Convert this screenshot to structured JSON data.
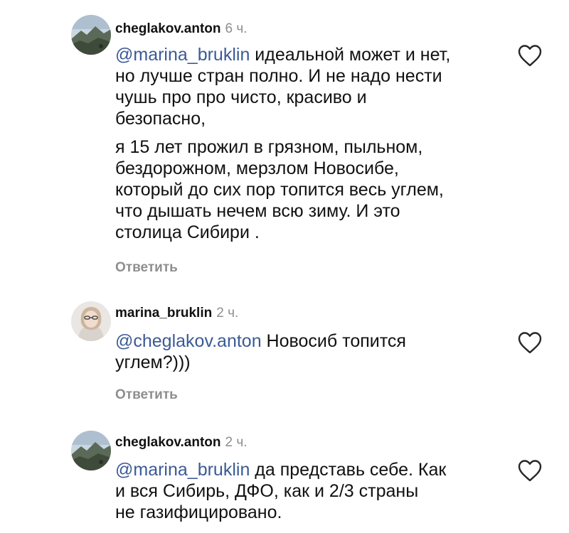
{
  "comments": [
    {
      "username": "cheglakov.anton",
      "time": "6 ч.",
      "mention": "@marina_bruklin",
      "text_first": " идеальной может и нет,",
      "lines_first": [
        "но лучше стран полно. И не надо нести",
        "чушь про про чисто, красиво и",
        "безопасно,"
      ],
      "paragraph_two": [
        "я 15 лет прожил в грязном, пыльном,",
        "бездорожном, мерзлом Новосибе,",
        "который до сих пор топится весь углем,",
        "что дышать нечем всю зиму. И это",
        "столица Сибири ."
      ],
      "reply_label": "Ответить",
      "avatar_icon": "mountain-landscape-avatar",
      "like_icon": "heart-outline-icon"
    },
    {
      "username": "marina_bruklin",
      "time": "2 ч.",
      "mention": "@cheglakov.anton",
      "text_first": " Новосиб топится",
      "lines_first": [
        "углем?)))"
      ],
      "reply_label": "Ответить",
      "avatar_icon": "woman-portrait-avatar",
      "like_icon": "heart-outline-icon"
    },
    {
      "username": "cheglakov.anton",
      "time": "2 ч.",
      "mention": "@marina_bruklin",
      "text_first": " да представь себе. Как",
      "lines_first": [
        "и вся Сибирь, ДФО, как  и 2/3 страны",
        "не газифицировано."
      ],
      "avatar_icon": "mountain-landscape-avatar",
      "like_icon": "heart-outline-icon"
    }
  ],
  "colors": {
    "text": "#111111",
    "secondary": "#8e8e8e",
    "mention": "#3b5a96"
  }
}
